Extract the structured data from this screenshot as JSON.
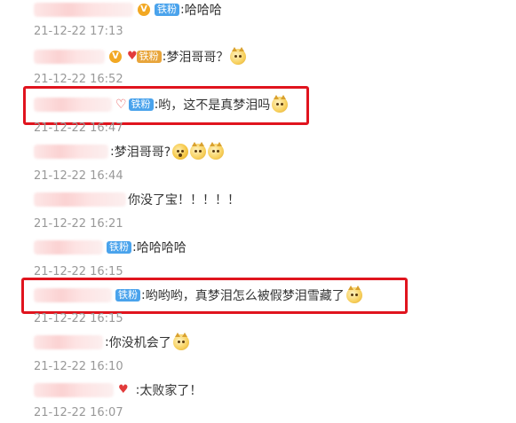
{
  "badges": {
    "iron_fan": "铁粉"
  },
  "comments": [
    {
      "text": "哈哈哈",
      "time": "21-12-22 17:13"
    },
    {
      "text": "梦泪哥哥？",
      "time": "21-12-22 16:52"
    },
    {
      "text": "哟，这不是真梦泪吗",
      "time": "21-12-22 16:47"
    },
    {
      "text": "梦泪哥哥?",
      "time": "21-12-22 16:44"
    },
    {
      "text": "你没了宝！！！！！",
      "time": "21-12-22 16:21"
    },
    {
      "text": "哈哈哈哈",
      "time": "21-12-22 16:15"
    },
    {
      "text": "哟哟哟，真梦泪怎么被假梦泪雪藏了",
      "time": "21-12-22 16:15"
    },
    {
      "text": "你没机会了",
      "time": "21-12-22 16:10"
    },
    {
      "text": "太败家了！",
      "time": "21-12-22 16:07"
    }
  ],
  "icons": [
    "vip-icon",
    "heart-badge-icon",
    "dog-emoji-icon",
    "surprised-emoji-icon"
  ],
  "colors": {
    "highlight_box": "#e0141e",
    "badge": "#4aa3ec",
    "time": "#999999"
  }
}
